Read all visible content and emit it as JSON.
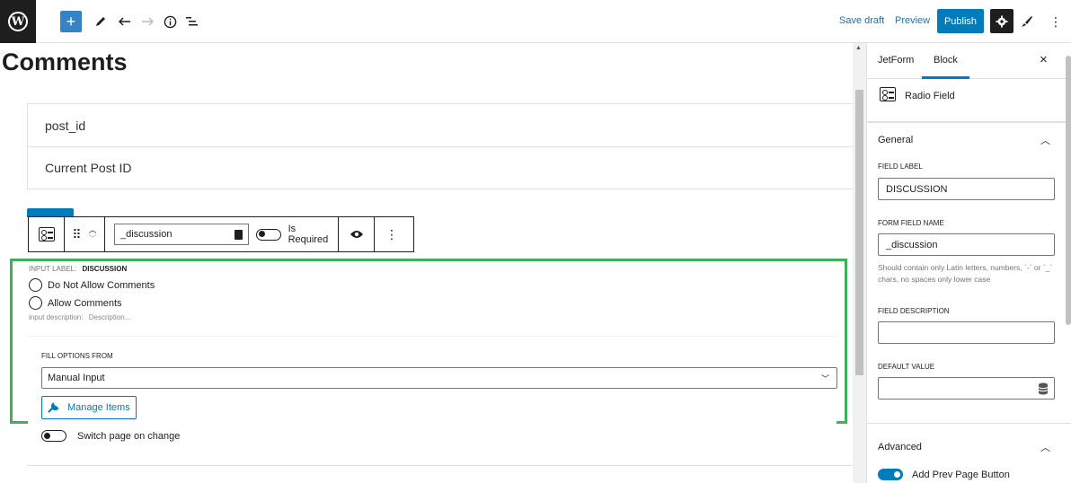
{
  "toolbar": {
    "add_icon": "plus-icon",
    "tool_icon": "pencil-icon",
    "undo_icon": "undo-icon",
    "redo_icon": "redo-icon",
    "info_icon": "info-icon",
    "list_icon": "list-view-icon",
    "save_draft": "Save draft",
    "preview": "Preview",
    "publish": "Publish"
  },
  "page": {
    "title": "Comments"
  },
  "card": {
    "row1": "post_id",
    "row2": "Current Post ID"
  },
  "block_toolbar": {
    "field_name": "_discussion",
    "required_label": "Is Required"
  },
  "radio_block": {
    "input_label_prefix": "INPUT LABEL:",
    "input_label": "DISCUSSION",
    "options": [
      "Do Not Allow Comments",
      "Allow Comments"
    ],
    "desc_prefix": "input description:",
    "desc_value": "Description...",
    "fill_label": "FILL OPTIONS FROM",
    "fill_value": "Manual Input",
    "manage_items": "Manage Items",
    "switch_label": "Switch page on change"
  },
  "sidebar": {
    "tabs": [
      "JetForm",
      "Block"
    ],
    "active_tab": "Block",
    "block_name": "Radio Field",
    "general": "General",
    "field_label_title": "FIELD LABEL",
    "field_label_value": "DISCUSSION",
    "form_field_name_title": "FORM FIELD NAME",
    "form_field_name_value": "_discussion",
    "name_help": "Should contain only Latin letters, numbers, `-` or `_` chars, no spaces only lower case",
    "field_desc_title": "FIELD DESCRIPTION",
    "field_desc_value": "",
    "default_value_title": "DEFAULT VALUE",
    "default_value_value": "",
    "advanced": "Advanced",
    "prev_page_label": "Add Prev Page Button"
  },
  "colors": {
    "accent": "#007cba",
    "highlight_border": "#3db359"
  }
}
